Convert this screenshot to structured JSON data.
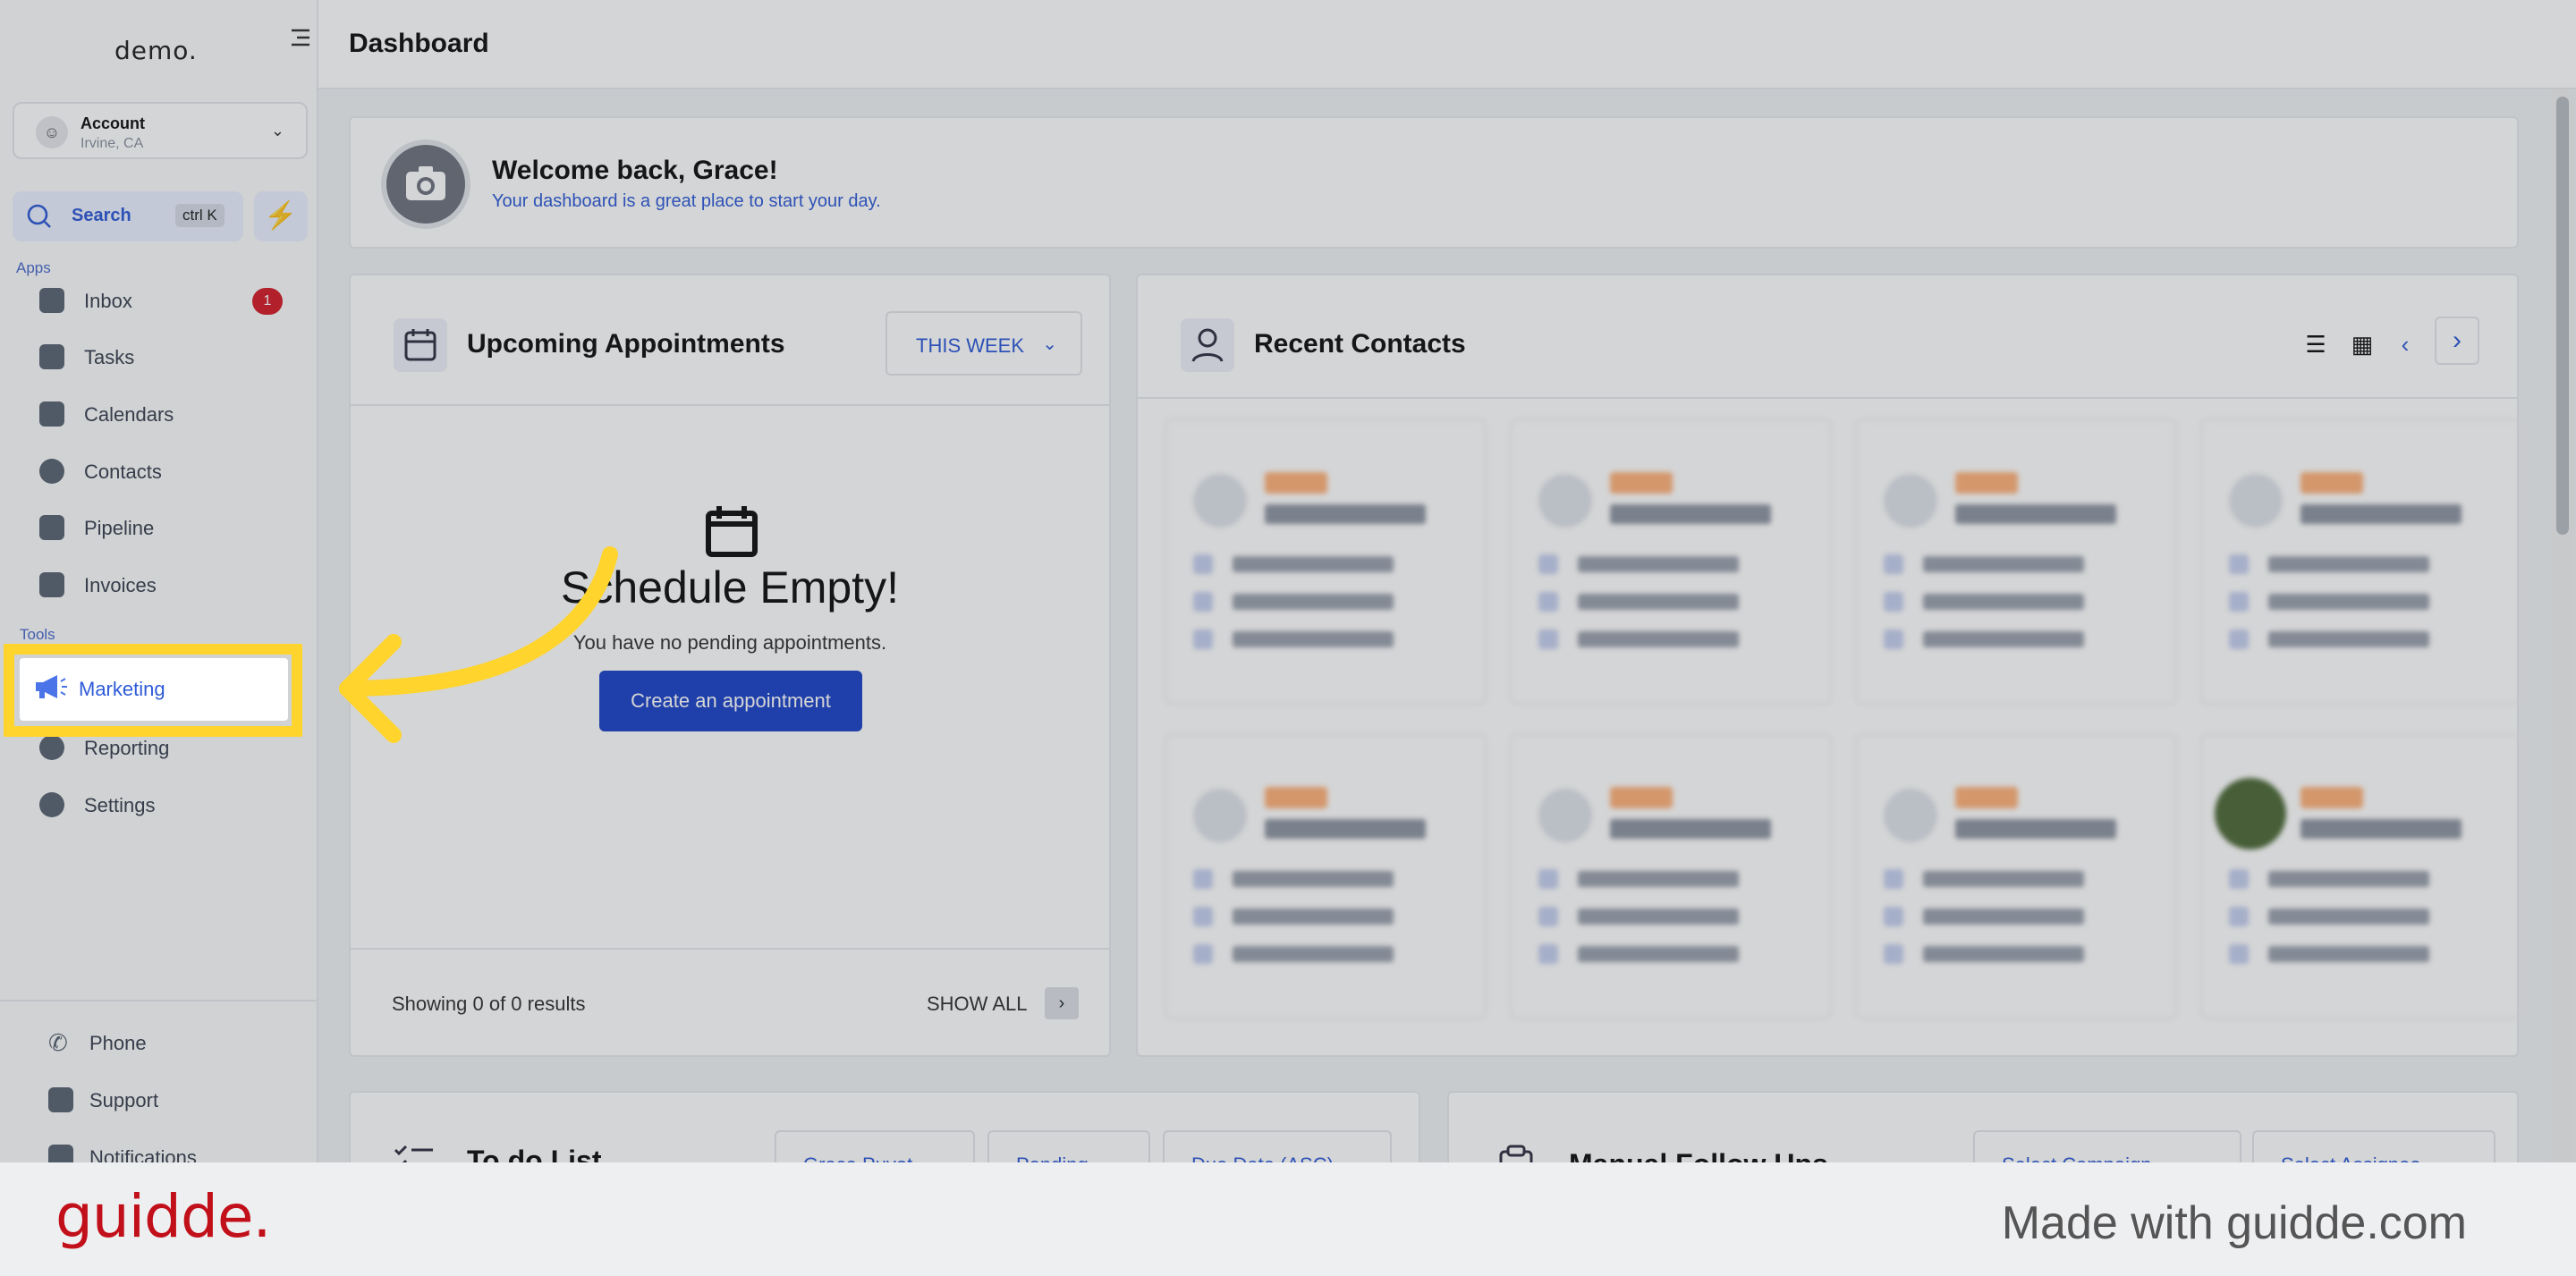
{
  "sidebar": {
    "brand": "demo.",
    "account": {
      "name": "Account",
      "location": "Irvine, CA"
    },
    "search": {
      "label": "Search",
      "shortcut": "ctrl K"
    },
    "apps_label": "Apps",
    "tools_label": "Tools",
    "apps": [
      {
        "label": "Inbox",
        "badge": "1"
      },
      {
        "label": "Tasks"
      },
      {
        "label": "Calendars"
      },
      {
        "label": "Contacts"
      },
      {
        "label": "Pipeline"
      },
      {
        "label": "Invoices"
      }
    ],
    "tools": [
      {
        "label": "Marketing"
      },
      {
        "label": "Reporting"
      },
      {
        "label": "Settings"
      }
    ],
    "footer": [
      {
        "label": "Phone"
      },
      {
        "label": "Support"
      },
      {
        "label": "Notifications"
      }
    ]
  },
  "header": {
    "title": "Dashboard"
  },
  "welcome": {
    "title": "Welcome back, Grace!",
    "subtitle": "Your dashboard is a great place to start your day."
  },
  "appointments": {
    "title": "Upcoming Appointments",
    "filter": "THIS WEEK",
    "empty_title": "Schedule Empty!",
    "empty_text": "You have no pending appointments.",
    "create_label": "Create an appointment",
    "showing": "Showing 0 of 0 results",
    "show_all": "SHOW ALL"
  },
  "recent_contacts": {
    "title": "Recent Contacts"
  },
  "todo": {
    "title": "To do List",
    "filters": [
      "Grace Puyot",
      "Pending",
      "Due Date (ASC)"
    ]
  },
  "follow_ups": {
    "title": "Manual Follow Ups",
    "filters": [
      "Select Campaign",
      "Select Assignee"
    ]
  },
  "footer": {
    "logo": "guidde.",
    "made_with": "Made with guidde.com"
  },
  "colors": {
    "accent": "#2f5bd8",
    "highlight": "#ffd42c",
    "badge": "#d51f2a",
    "brand": "#c2101b"
  }
}
